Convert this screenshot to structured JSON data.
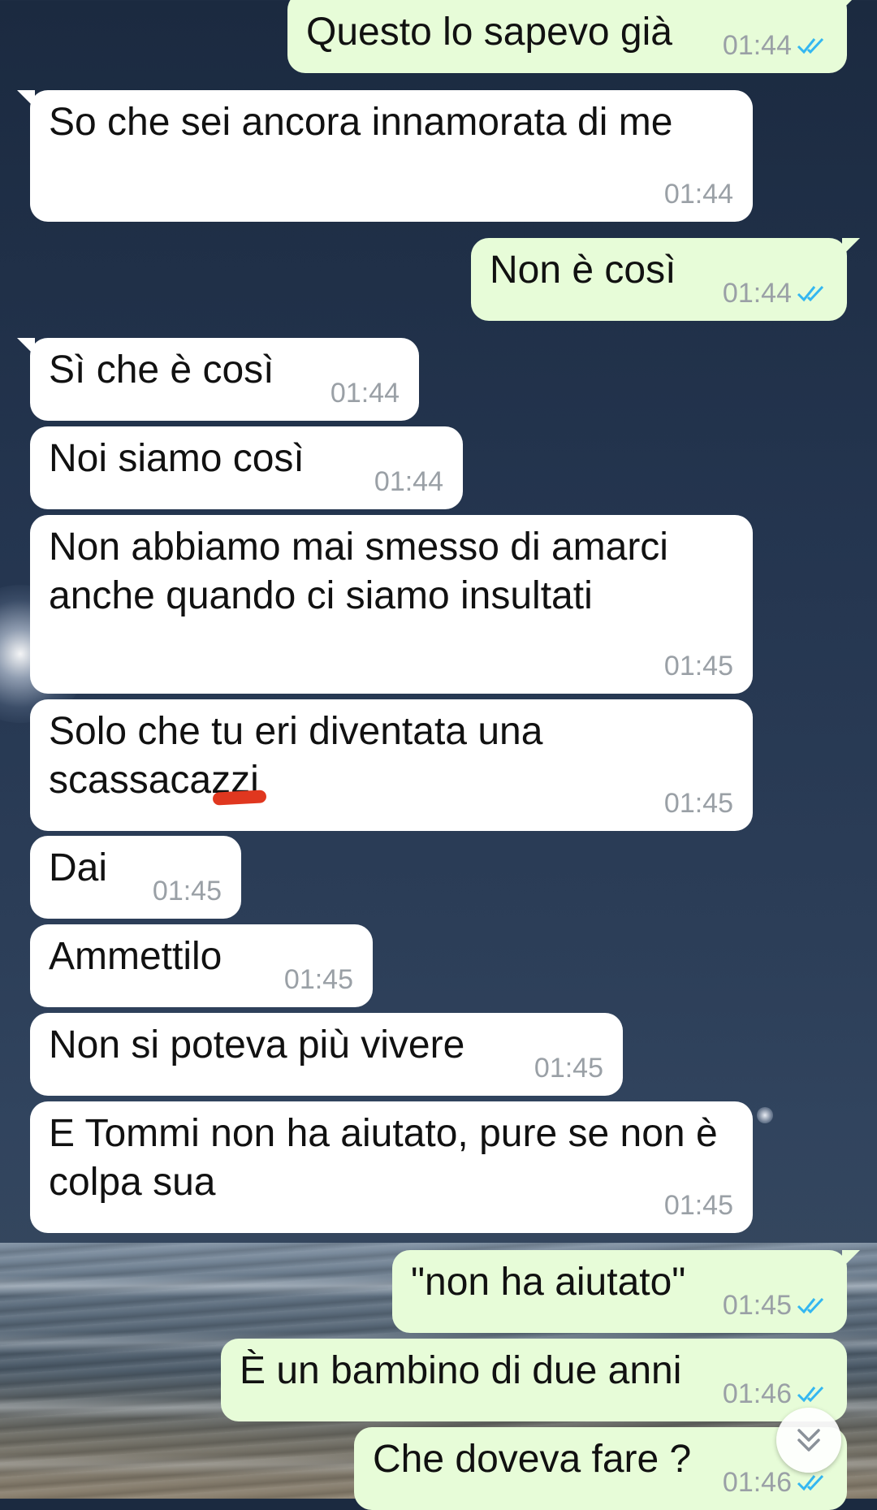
{
  "chat": {
    "messages": [
      {
        "dir": "out",
        "text": "Questo lo sapevo già",
        "time": "01:44",
        "status": "read"
      },
      {
        "dir": "in",
        "text": "So che sei ancora innamorata di me",
        "time": "01:44"
      },
      {
        "dir": "out",
        "text": "Non è così",
        "time": "01:44",
        "status": "read"
      },
      {
        "dir": "in",
        "text": "Sì che è così",
        "time": "01:44"
      },
      {
        "dir": "in",
        "text": "Noi siamo così",
        "time": "01:44"
      },
      {
        "dir": "in",
        "text": "Non abbiamo mai smesso di amarci anche quando ci siamo insultati",
        "time": "01:45"
      },
      {
        "dir": "in",
        "text": "Solo che tu eri diventata una scassacazzi",
        "time": "01:45"
      },
      {
        "dir": "in",
        "text": "Dai",
        "time": "01:45"
      },
      {
        "dir": "in",
        "text": "Ammettilo",
        "time": "01:45"
      },
      {
        "dir": "in",
        "text": "Non si poteva più vivere",
        "time": "01:45"
      },
      {
        "dir": "in",
        "text": "E Tommi non ha aiutato, pure se non è colpa sua",
        "time": "01:45"
      },
      {
        "dir": "out",
        "text": "\"non ha aiutato\"",
        "time": "01:45",
        "status": "read"
      },
      {
        "dir": "out",
        "text": "È un bambino di due anni",
        "time": "01:46",
        "status": "read"
      },
      {
        "dir": "out",
        "text": "Che doveva fare ?",
        "time": "01:46",
        "status": "read"
      }
    ]
  },
  "icons": {
    "read_receipt": "double-check-icon",
    "scroll_down": "double-chevron-down-icon",
    "redaction": "red-strike-mark"
  },
  "colors": {
    "incoming_bubble": "#ffffff",
    "outgoing_bubble": "#e7fcd8",
    "read_tick": "#34b7f1",
    "timestamp": "#9aa0a6",
    "redaction_mark": "#e0371f"
  }
}
